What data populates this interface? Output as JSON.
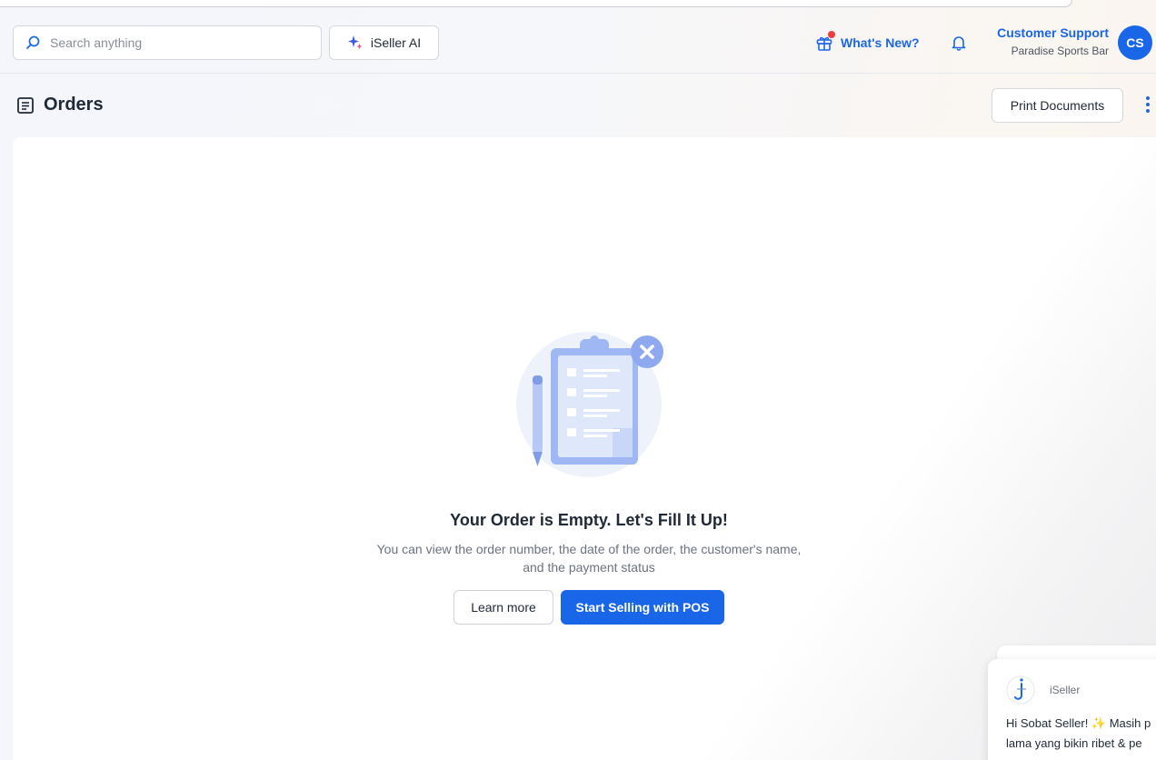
{
  "search": {
    "placeholder": "Search anything"
  },
  "ai_button": {
    "label": "iSeller AI"
  },
  "whats_new": {
    "label": "What's New?"
  },
  "user": {
    "name": "Customer Support",
    "store": "Paradise Sports Bar",
    "initials": "CS"
  },
  "page": {
    "title": "Orders",
    "print_label": "Print Documents"
  },
  "empty_state": {
    "title": "Your Order is Empty. Let's Fill It Up!",
    "description": "You can view the order number, the date of the order, the customer's name, and the payment status",
    "learn_more_label": "Learn more",
    "start_selling_label": "Start Selling with POS"
  },
  "chat": {
    "sender": "iSeller",
    "message_line1": "Hi Sobat Seller! ✨ Masih p",
    "message_line2": "lama yang bikin ribet & pe"
  },
  "colors": {
    "primary": "#1a66e8",
    "notification_dot": "#ef3b3b"
  }
}
